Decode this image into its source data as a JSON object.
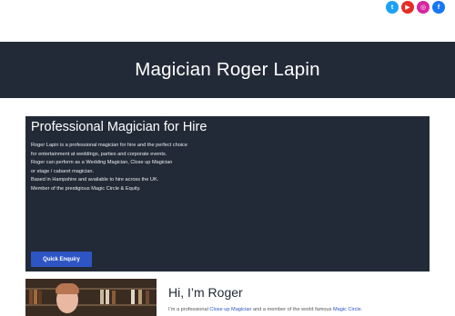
{
  "social": [
    {
      "name": "Twitter",
      "glyph": "t"
    },
    {
      "name": "YouTube",
      "glyph": "▶"
    },
    {
      "name": "Instagram",
      "glyph": "◎"
    },
    {
      "name": "Facebook",
      "glyph": "f"
    }
  ],
  "header": {
    "site_title": "Magician Roger Lapin"
  },
  "hero": {
    "title": "Professional Magician for Hire",
    "lines": [
      "Roger Lapin is a professional magician for hire and the perfect choice",
      "for entertainment at weddings, parties and corporate events.",
      "Roger can perform as a Wedding Magician, Close up Magician",
      "or stage / cabaret magician.",
      "Based in Hampshire and available to hire across the UK.",
      "Member of the prestigious Magic Circle & Equity."
    ],
    "cta_label": "Quick Enquiry"
  },
  "intro": {
    "title": "Hi, I’m Roger",
    "text_before": "I’m a professional ",
    "link1": "Close up Magician",
    "text_middle": " and a member of the world famous ",
    "link2": "Magic Circle",
    "text_after": "."
  },
  "colors": {
    "header_bg": "#232a37",
    "accent": "#2e55c4"
  }
}
